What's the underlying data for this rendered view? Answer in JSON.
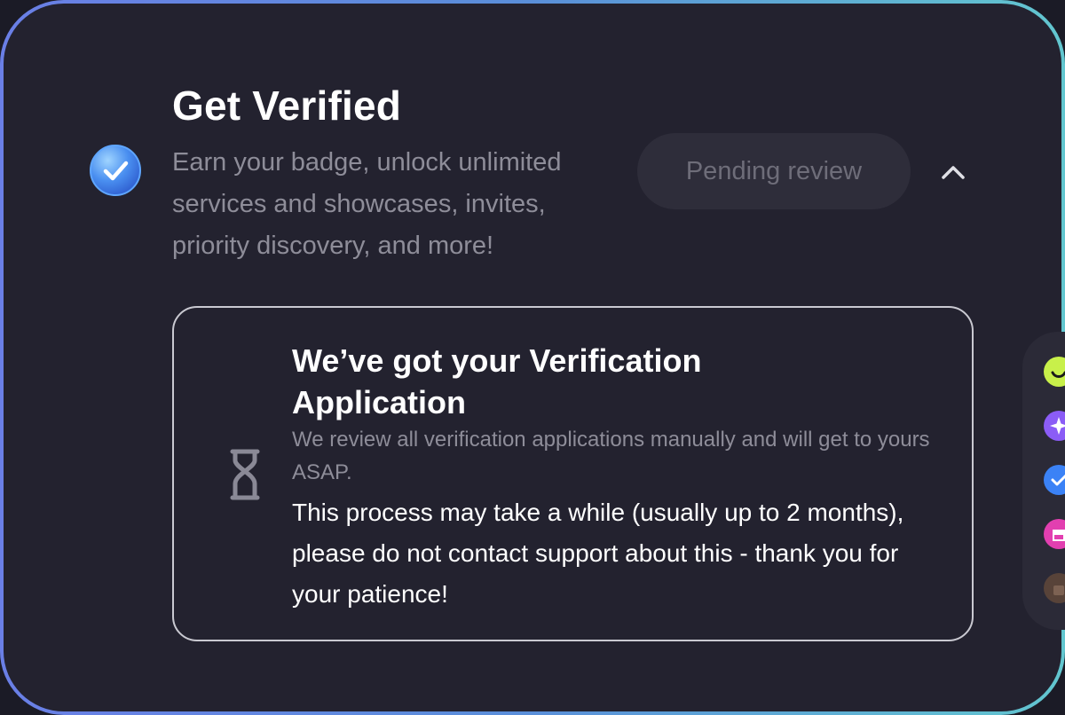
{
  "colors": {
    "frame_gradient_start": "#6a7fe6",
    "frame_gradient_end": "#62c6cf",
    "card_background": "#23222f",
    "muted_text": "#8e8d99",
    "pending_button_bg": "#2e2d3a",
    "badge_blue": "#3b7fe0"
  },
  "verify": {
    "title": "Get Verified",
    "subtitle": "Earn your badge, unlock unlimited services and showcases, invites, priority discovery, and more!",
    "status_button": "Pending review",
    "badge_icon": "verified-badge-icon",
    "toggle_icon": "chevron-up-icon"
  },
  "notice": {
    "icon": "hourglass-icon",
    "title": "We’ve got your Verification Application",
    "subtitle": "We review all verification applications manually and will get to yours ASAP.",
    "body": "This process may take a while (usually up to 2 months), please do not contact support about this - thank you for your patience!"
  },
  "dock": {
    "items": [
      {
        "icon": "smile-icon",
        "color": "#c8f04a"
      },
      {
        "icon": "sparkle-icon",
        "color": "#8b5cf6"
      },
      {
        "icon": "verified-icon",
        "color": "#3b82f6"
      },
      {
        "icon": "store-icon",
        "color": "#e23fb0"
      },
      {
        "icon": "bag-icon",
        "color": "#6b4e3a"
      }
    ]
  }
}
